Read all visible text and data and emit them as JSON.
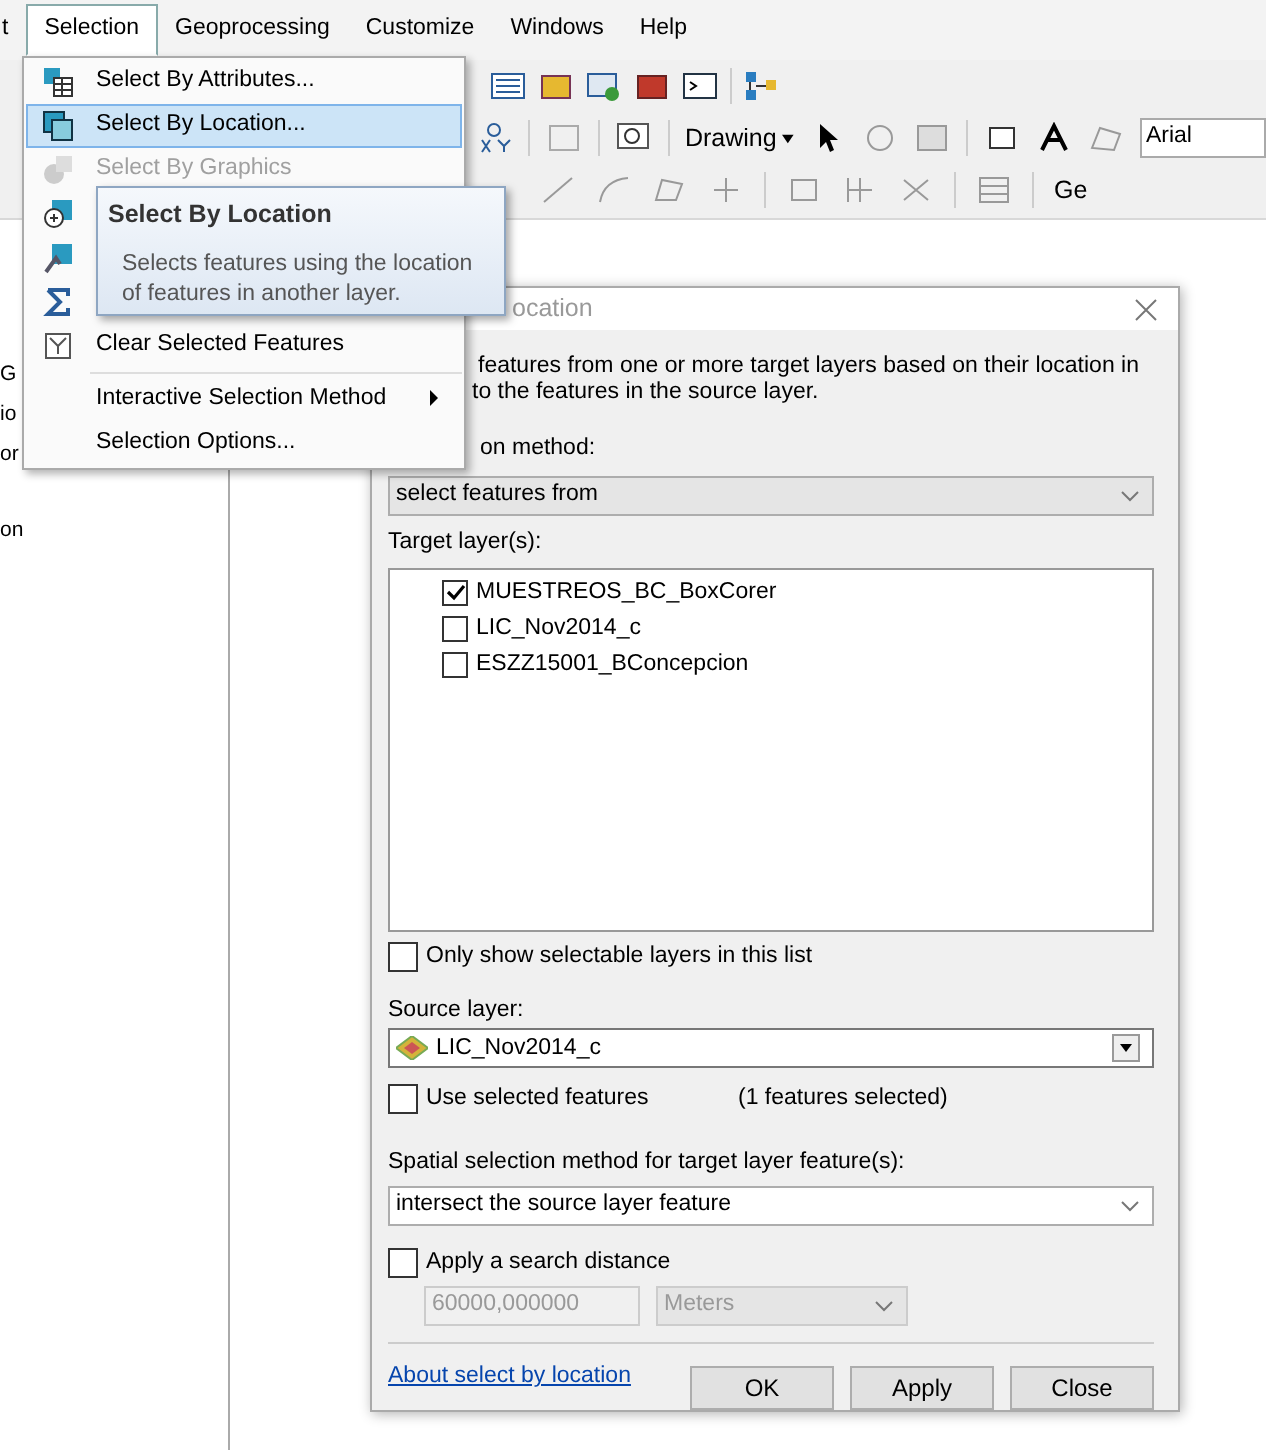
{
  "menubar": [
    {
      "label": "t",
      "selected": false
    },
    {
      "label": "Selection",
      "selected": true
    },
    {
      "label": "Geoprocessing",
      "selected": false
    },
    {
      "label": "Customize",
      "selected": false
    },
    {
      "label": "Windows",
      "selected": false
    },
    {
      "label": "Help",
      "selected": false
    }
  ],
  "toolbar": {
    "drawing_menu": "Drawing",
    "font_field": "Arial",
    "toolbar_label": "Ge"
  },
  "left_panel_texts": [
    "G",
    "io",
    "or",
    "on"
  ],
  "menu": {
    "items": [
      {
        "kind": "item",
        "label": "Select By Attributes...",
        "selected": false,
        "disabled": false,
        "has_submenu": false
      },
      {
        "kind": "item",
        "label": "Select By Location...",
        "selected": true,
        "disabled": false,
        "has_submenu": false
      },
      {
        "kind": "item",
        "label": "Select By Graphics",
        "selected": false,
        "disabled": true,
        "has_submenu": false
      },
      {
        "kind": "covered"
      },
      {
        "kind": "covered"
      },
      {
        "kind": "covered"
      },
      {
        "kind": "item",
        "label": "Clear Selected Features",
        "selected": false,
        "disabled": false,
        "has_submenu": false
      },
      {
        "kind": "separator"
      },
      {
        "kind": "item",
        "label": "Interactive Selection Method",
        "selected": false,
        "disabled": false,
        "has_submenu": true
      },
      {
        "kind": "item",
        "label": "Selection Options...",
        "selected": false,
        "disabled": false,
        "has_submenu": false
      }
    ]
  },
  "tooltip": {
    "title": "Select By Location",
    "text": "Selects features using the location of features in another layer."
  },
  "dialog": {
    "title": "ocation",
    "description": [
      "features from one or more target layers based on their location in",
      "to the features in the source layer."
    ],
    "method_label": "on method:",
    "method_value": "select features from",
    "target_label": "Target layer(s):",
    "target_layers": [
      {
        "name": "MUESTREOS_BC_BoxCorer",
        "checked": true
      },
      {
        "name": "LIC_Nov2014_c",
        "checked": false
      },
      {
        "name": "ESZZ15001_BConcepcion",
        "checked": false
      }
    ],
    "only_selectable": {
      "label": "Only show selectable layers in this list",
      "checked": false
    },
    "source_label": "Source layer:",
    "source_value": "LIC_Nov2014_c",
    "use_selected": {
      "label": "Use selected features",
      "checked": false
    },
    "selected_count": "(1 features selected)",
    "spatial_label": "Spatial selection method for target layer feature(s):",
    "spatial_value": "intersect the source layer feature",
    "search_distance": {
      "label": "Apply a search distance",
      "checked": false
    },
    "distance_value": "60000,000000",
    "unit_value": "Meters",
    "link": "About select by location",
    "buttons": [
      "OK",
      "Apply",
      "Close"
    ]
  }
}
